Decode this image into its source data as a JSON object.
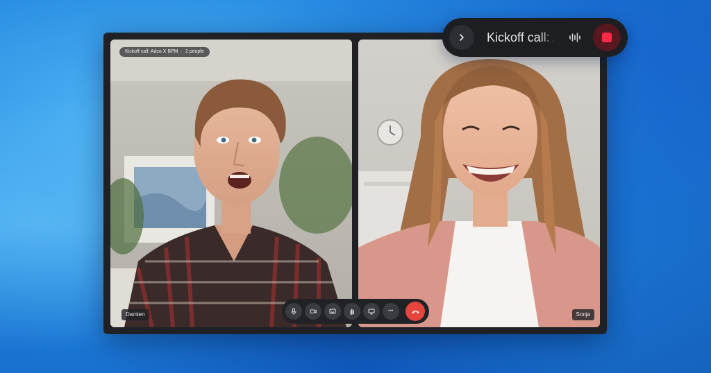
{
  "call": {
    "title": "Kickoff call: Adco X BPM",
    "separator": "·",
    "participants_count": "2 people"
  },
  "participants": [
    {
      "name": "Damien"
    },
    {
      "name": "Sonja"
    }
  ],
  "toolbar": {
    "buttons": [
      "microphone-icon",
      "camera-icon",
      "captions-icon",
      "raise-hand-icon",
      "share-screen-icon",
      "more-icon",
      "end-call-icon"
    ],
    "more_glyph": "•••"
  },
  "recorder": {
    "title": "Kickoff call: Adco X BPM"
  },
  "colors": {
    "end_call": "#e5453a",
    "record_stop": "#ff2a45",
    "window_bg": "#1f2125"
  }
}
